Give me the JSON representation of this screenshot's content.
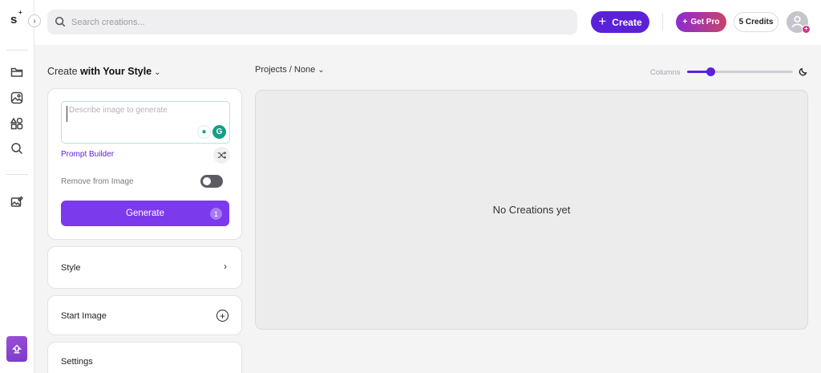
{
  "brand": {
    "logo_text": "s",
    "logo_mark": "+"
  },
  "topbar": {
    "search_placeholder": "Search creations...",
    "create_label": "Create",
    "get_pro_label": "Get Pro",
    "credits_label": "5 Credits"
  },
  "sidebar": {
    "icons": [
      "folder-icon",
      "image-icon",
      "shapes-icon",
      "search-icon",
      "gallery-edit-icon"
    ]
  },
  "panel": {
    "title_prefix": "Create ",
    "title_bold": "with Your Style",
    "prompt_placeholder": "Describe image to generate",
    "prompt_builder_label": "Prompt Builder",
    "remove_from_image_label": "Remove from Image",
    "remove_from_image_enabled": false,
    "generate_label": "Generate",
    "generate_count": "1",
    "style_label": "Style",
    "start_image_label": "Start Image",
    "settings_label": "Settings"
  },
  "main": {
    "breadcrumb": "Projects / None",
    "columns_label": "Columns",
    "columns_value_fraction": 0.22,
    "empty_text": "No Creations yet"
  },
  "colors": {
    "accent": "#5b21d9",
    "generate": "#7c3aed",
    "pro_gradient_start": "#8e2bd1",
    "pro_gradient_end": "#c6456a"
  }
}
